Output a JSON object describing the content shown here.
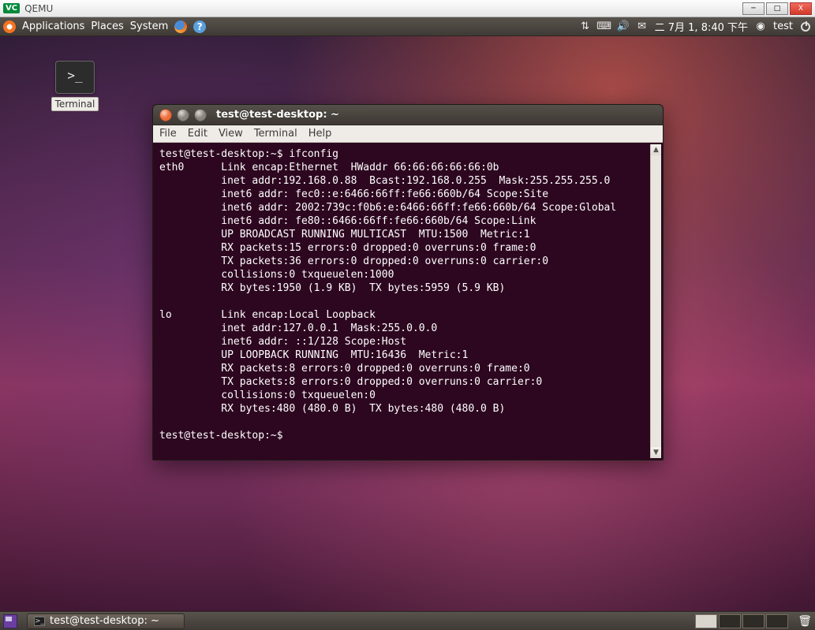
{
  "outer": {
    "app_title": "QEMU",
    "min": "─",
    "max": "□",
    "close": "X"
  },
  "panel": {
    "menus": {
      "applications": "Applications",
      "places": "Places",
      "system": "System"
    },
    "date": "二  7月  1,  8:40 下午",
    "user": "test"
  },
  "desktop_icon": {
    "glyph": ">_",
    "label": "Terminal"
  },
  "terminal": {
    "title": "test@test-desktop: ~",
    "menu": {
      "file": "File",
      "edit": "Edit",
      "view": "View",
      "terminal": "Terminal",
      "help": "Help"
    },
    "lines": [
      "test@test-desktop:~$ ifconfig",
      "eth0      Link encap:Ethernet  HWaddr 66:66:66:66:66:0b  ",
      "          inet addr:192.168.0.88  Bcast:192.168.0.255  Mask:255.255.255.0",
      "          inet6 addr: fec0::e:6466:66ff:fe66:660b/64 Scope:Site",
      "          inet6 addr: 2002:739c:f0b6:e:6466:66ff:fe66:660b/64 Scope:Global",
      "          inet6 addr: fe80::6466:66ff:fe66:660b/64 Scope:Link",
      "          UP BROADCAST RUNNING MULTICAST  MTU:1500  Metric:1",
      "          RX packets:15 errors:0 dropped:0 overruns:0 frame:0",
      "          TX packets:36 errors:0 dropped:0 overruns:0 carrier:0",
      "          collisions:0 txqueuelen:1000 ",
      "          RX bytes:1950 (1.9 KB)  TX bytes:5959 (5.9 KB)",
      "",
      "lo        Link encap:Local Loopback  ",
      "          inet addr:127.0.0.1  Mask:255.0.0.0",
      "          inet6 addr: ::1/128 Scope:Host",
      "          UP LOOPBACK RUNNING  MTU:16436  Metric:1",
      "          RX packets:8 errors:0 dropped:0 overruns:0 frame:0",
      "          TX packets:8 errors:0 dropped:0 overruns:0 carrier:0",
      "          collisions:0 txqueuelen:0 ",
      "          RX bytes:480 (480.0 B)  TX bytes:480 (480.0 B)",
      "",
      "test@test-desktop:~$ "
    ]
  },
  "taskbar": {
    "task_title": "test@test-desktop: ~"
  }
}
